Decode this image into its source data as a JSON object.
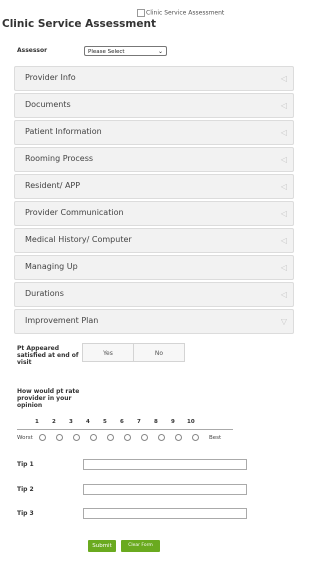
{
  "header": {
    "logo_alt": "Clinic Service Assessment",
    "title": "Clinic Service Assessment"
  },
  "assessor": {
    "label": "Assessor",
    "selected": "Please Select"
  },
  "sections": [
    {
      "label": "Provider Info",
      "state": "collapsed"
    },
    {
      "label": "Documents",
      "state": "collapsed"
    },
    {
      "label": "Patient Information",
      "state": "collapsed"
    },
    {
      "label": "Rooming Process",
      "state": "collapsed"
    },
    {
      "label": "Resident/ APP",
      "state": "collapsed"
    },
    {
      "label": "Provider Communication",
      "state": "collapsed"
    },
    {
      "label": "Medical History/ Computer",
      "state": "collapsed"
    },
    {
      "label": "Managing Up",
      "state": "collapsed"
    },
    {
      "label": "Durations",
      "state": "collapsed"
    },
    {
      "label": "Improvement Plan",
      "state": "expanded"
    }
  ],
  "icons": {
    "collapsed": "triangle-left-icon",
    "expanded": "triangle-down-icon"
  },
  "satisfied": {
    "label": "Pt Appeared satisfied at end of visit",
    "yes": "Yes",
    "no": "No"
  },
  "rating": {
    "label": "How would pt rate provider in your opinion",
    "scale": [
      "1",
      "2",
      "3",
      "4",
      "5",
      "6",
      "7",
      "8",
      "9",
      "10"
    ],
    "low_label": "Worst",
    "high_label": "Best"
  },
  "tips": [
    {
      "label": "Tip 1",
      "value": ""
    },
    {
      "label": "Tip 2",
      "value": ""
    },
    {
      "label": "Tip 3",
      "value": ""
    }
  ],
  "actions": {
    "submit": "Submit",
    "clear": "Clear Form",
    "color": "#6aaa1f"
  }
}
